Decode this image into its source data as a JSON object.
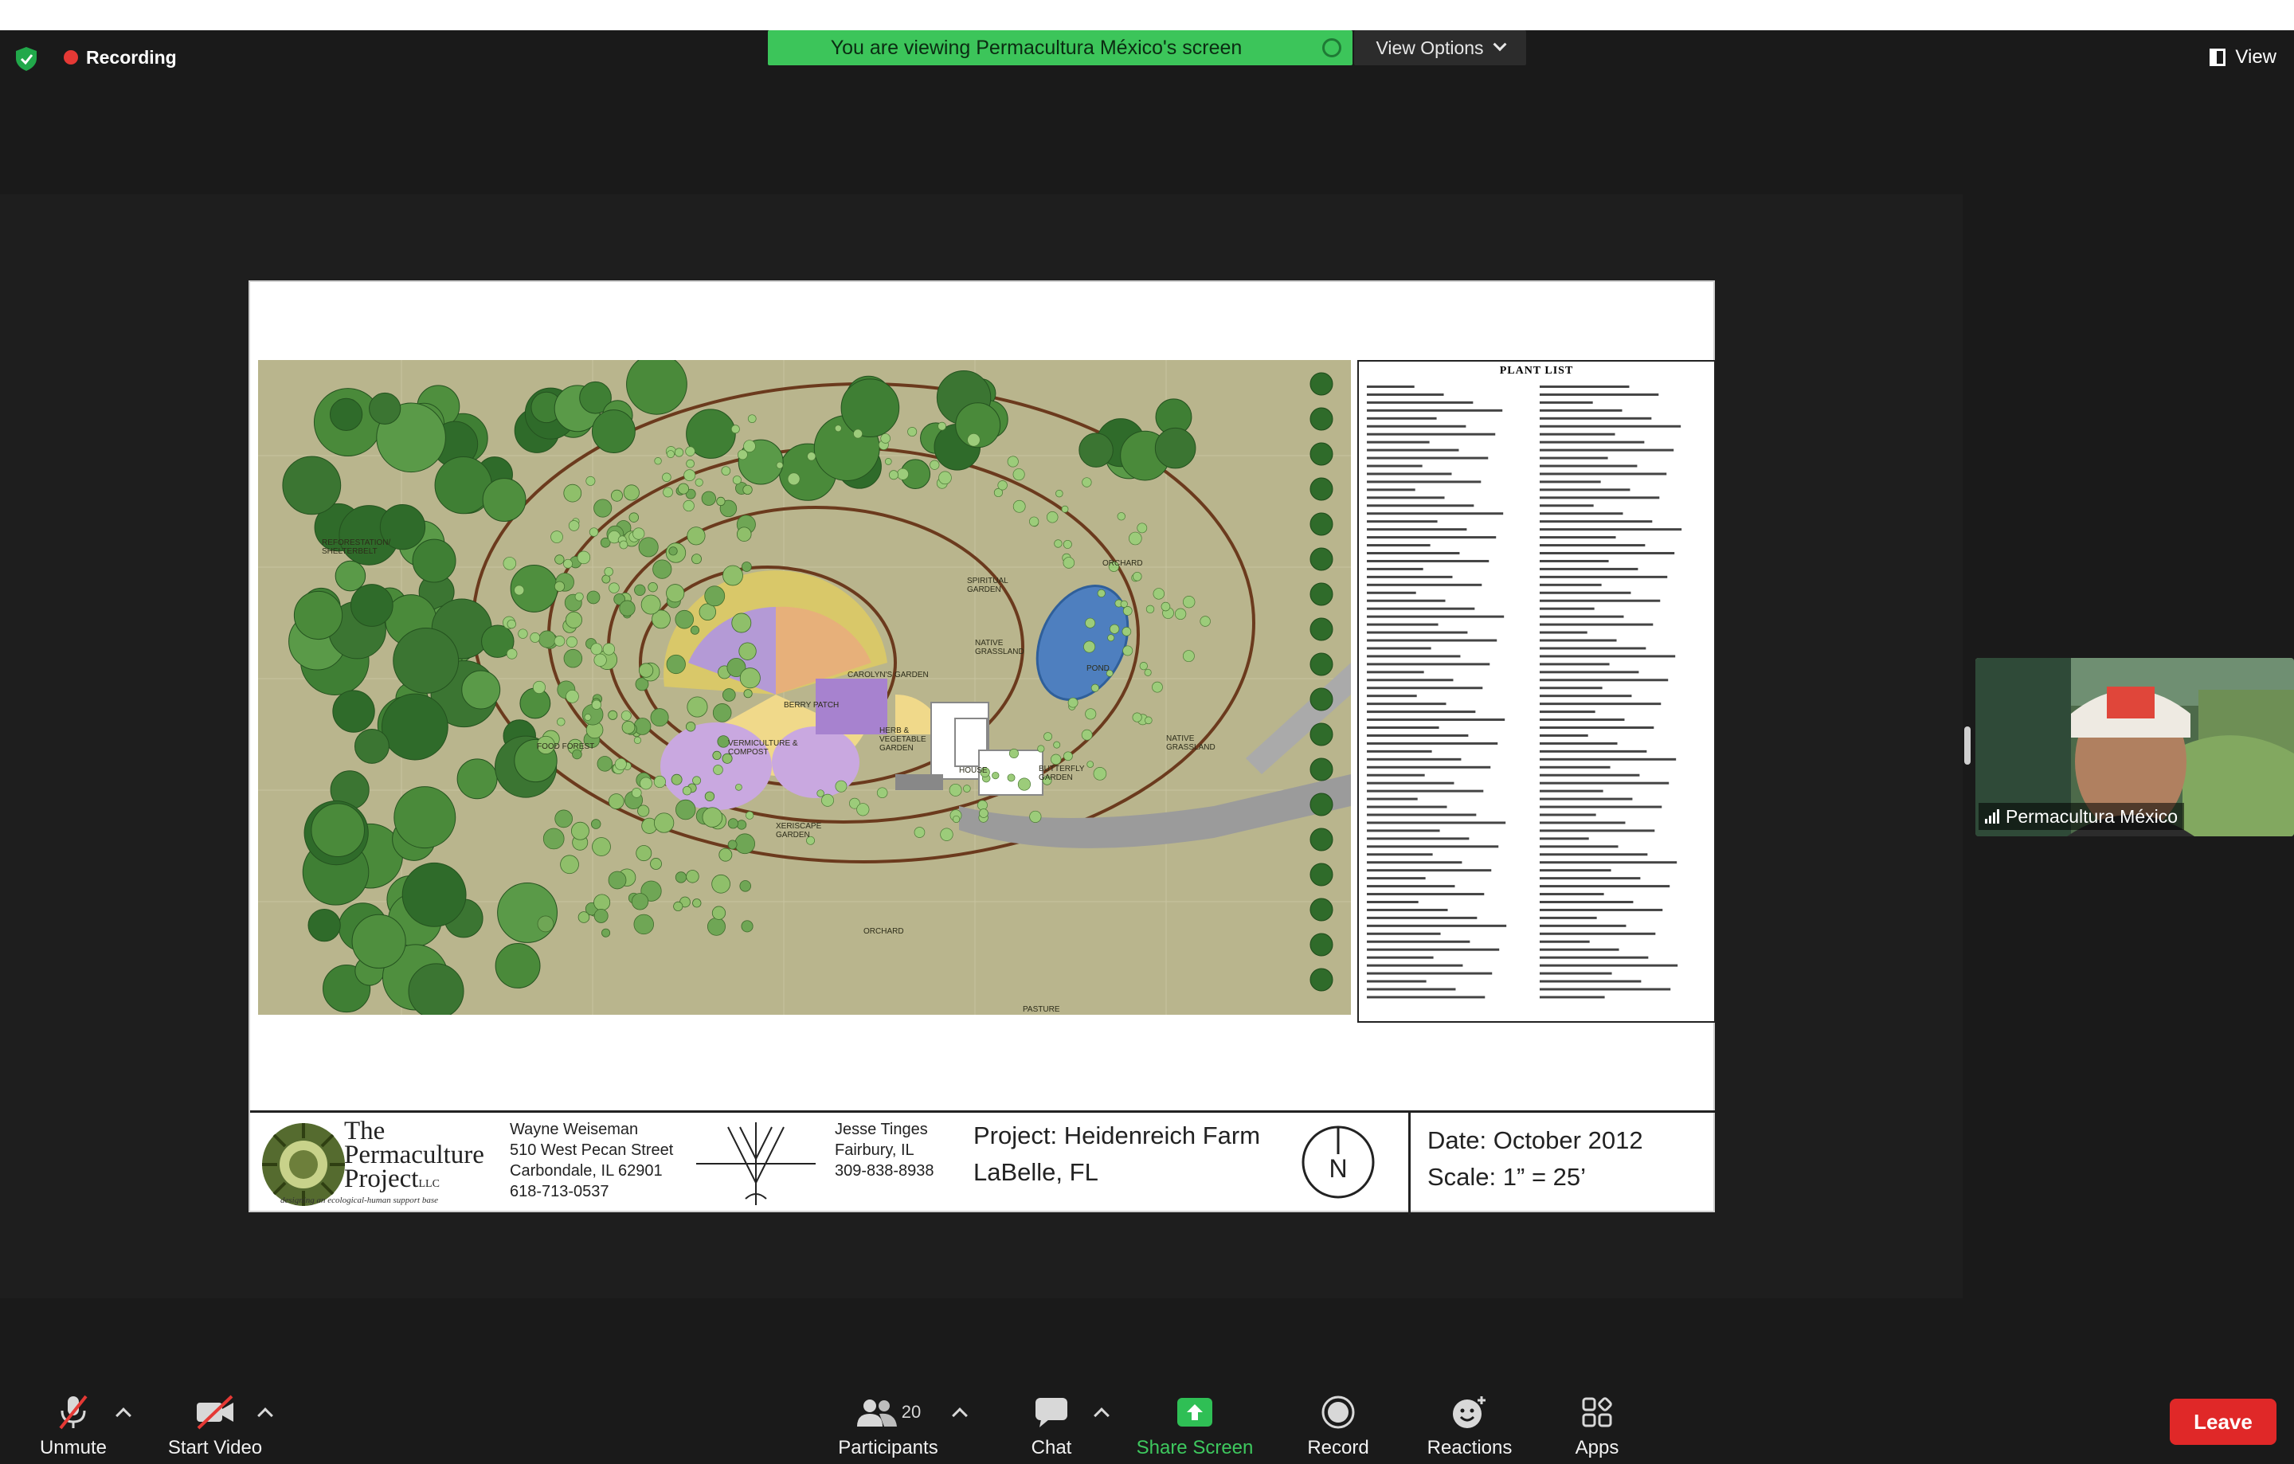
{
  "recording": {
    "label": "Recording"
  },
  "banner": {
    "text": "You are viewing Permacultura México's screen",
    "view_options": "View Options"
  },
  "view_button": {
    "label": "View"
  },
  "document": {
    "plant_list_title": "PLANT LIST",
    "logo": {
      "line1": "The",
      "line2": "Permaculture",
      "line3": "Project",
      "suffix": "LLC",
      "tagline": "designing an ecological-human support base"
    },
    "designer": {
      "name": "Wayne Weiseman",
      "street": "510 West Pecan Street",
      "city": "Carbondale, IL 62901",
      "phone": "618-713-0537"
    },
    "client": {
      "name": "Jesse Tinges",
      "city": "Fairbury, IL",
      "phone": "309-838-8938"
    },
    "project": {
      "line1": "Project: Heidenreich Farm",
      "line2": "LaBelle, FL"
    },
    "north": "N",
    "date": "Date: October 2012",
    "scale": "Scale: 1” = 25’",
    "map_labels": {
      "reforestation": "REFORESTATION/ SHELTERBELT",
      "orchard_top": "ORCHARD",
      "native_grassland_1": "NATIVE GRASSLAND",
      "pond": "POND",
      "native_grassland_2": "NATIVE GRASSLAND",
      "carolyns_garden": "CAROLYN'S GARDEN",
      "berry_patch": "BERRY PATCH",
      "vermiculture": "VERMICULTURE & COMPOST",
      "herb_garden": "HERB & VEGETABLE GARDEN",
      "house": "HOUSE",
      "butterfly_garden": "BUTTERFLY GARDEN",
      "food_forest": "FOOD FOREST",
      "spiritual_garden": "SPIRITUAL GARDEN",
      "xeriscape": "XERISCAPE GARDEN",
      "orchard_bottom": "ORCHARD",
      "pasture": "PASTURE"
    }
  },
  "participant": {
    "name": "Permacultura México"
  },
  "toolbar": {
    "unmute": "Unmute",
    "start_video": "Start Video",
    "participants": "Participants",
    "participants_count": "20",
    "chat": "Chat",
    "share_screen": "Share Screen",
    "record": "Record",
    "reactions": "Reactions",
    "apps": "Apps",
    "leave": "Leave"
  },
  "colors": {
    "banner": "#3cc55a",
    "leave": "#e02828",
    "share": "#3ec85e",
    "recording_dot": "#e53935"
  }
}
